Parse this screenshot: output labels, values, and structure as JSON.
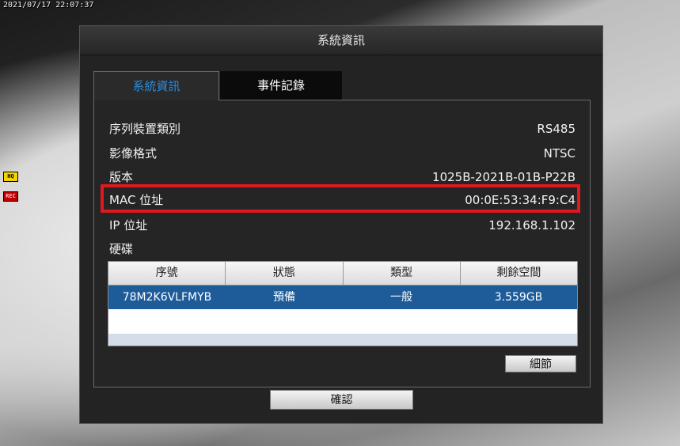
{
  "osd": {
    "timestamp": "2021/07/17 22:07:37",
    "quality_badge": "HQ",
    "rec_badge": "REC"
  },
  "window": {
    "title": "系統資訊"
  },
  "tabs": [
    {
      "label": "系統資訊",
      "active": true
    },
    {
      "label": "事件記錄",
      "active": false
    }
  ],
  "info": {
    "serial_device_type": {
      "label": "序列裝置類別",
      "value": "RS485"
    },
    "video_format": {
      "label": "影像格式",
      "value": "NTSC"
    },
    "version": {
      "label": "版本",
      "value": "1025B-2021B-01B-P22B"
    },
    "mac": {
      "label": "MAC 位址",
      "value": "00:0E:53:34:F9:C4"
    },
    "ip": {
      "label": "IP 位址",
      "value": "192.168.1.102"
    },
    "hdd": {
      "label": "硬碟"
    }
  },
  "hdd_table": {
    "columns": [
      "序號",
      "狀態",
      "類型",
      "剩餘空間"
    ],
    "rows": [
      [
        "78M2K6VLFMYB",
        "預備",
        "一般",
        "3.559GB"
      ]
    ]
  },
  "buttons": {
    "detail": "細節",
    "confirm": "確認"
  },
  "colors": {
    "highlight_border": "#e0191f",
    "active_tab_text": "#2a8de0",
    "selected_row": "#1e5b99"
  }
}
